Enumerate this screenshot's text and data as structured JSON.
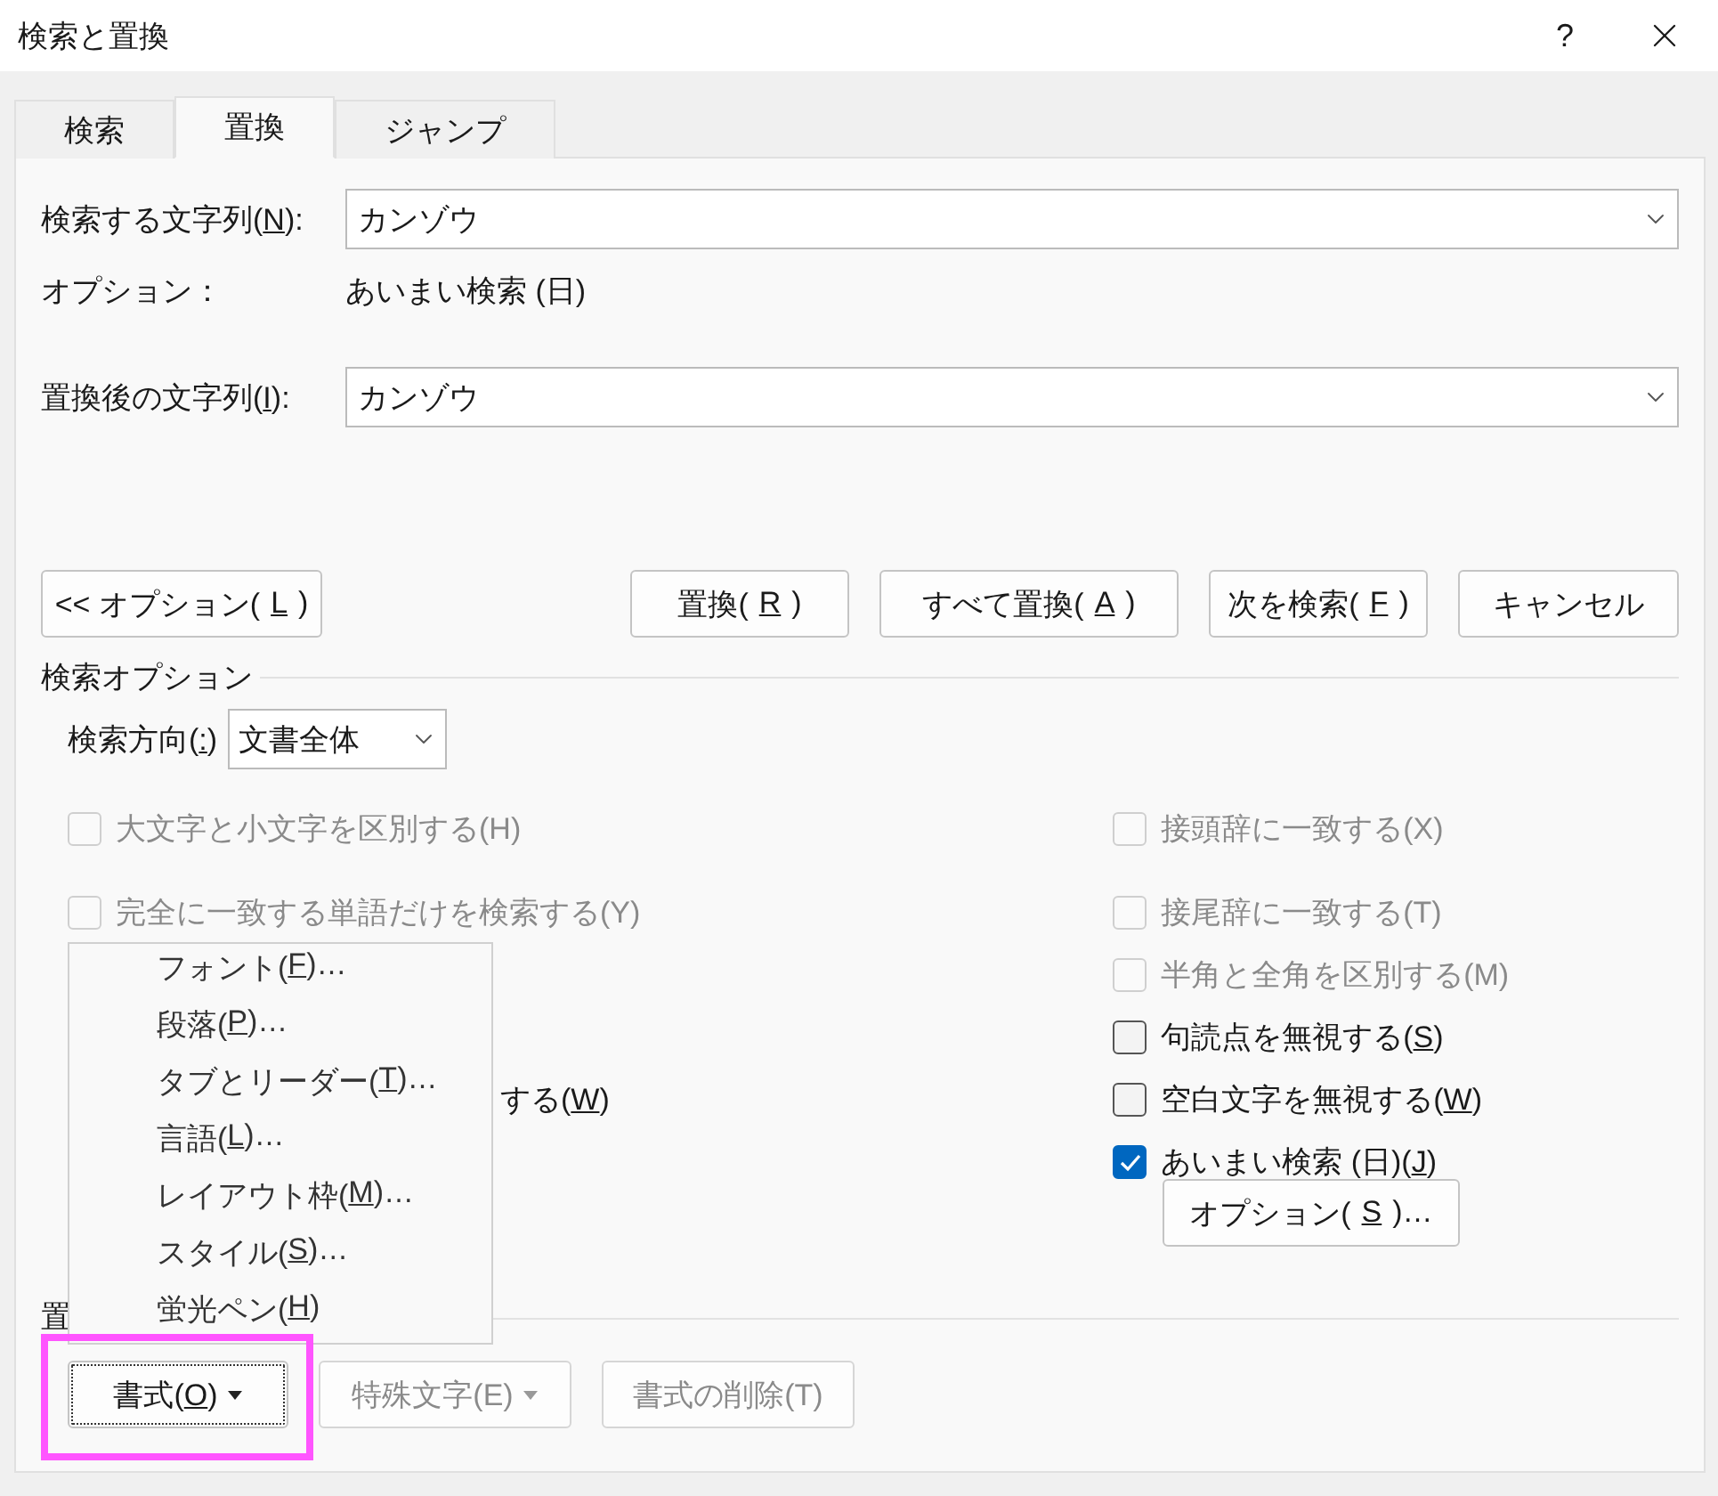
{
  "window": {
    "title": "検索と置換",
    "help": "?"
  },
  "tabs": [
    {
      "label": "検索",
      "selected": false
    },
    {
      "label": "置換",
      "selected": true
    },
    {
      "label": "ジャンプ",
      "selected": false
    }
  ],
  "find": {
    "label": [
      "検索する文字列(",
      "N",
      "):"
    ],
    "value": "カンゾウ"
  },
  "options_line": {
    "label": "オプション：",
    "value": "あいまい検索 (日)"
  },
  "replace": {
    "label": [
      "置換後の文字列(",
      "I",
      "):"
    ],
    "value": "カンゾウ"
  },
  "buttons": [
    {
      "label": [
        "<< オプション(",
        "L",
        ")"
      ]
    },
    {
      "label": [
        "置換(",
        "R",
        ")"
      ]
    },
    {
      "label": [
        "すべて置換(",
        "A",
        ")"
      ]
    },
    {
      "label": [
        "次を検索(",
        "F",
        ")"
      ]
    },
    {
      "label": "キャンセル"
    }
  ],
  "search_options": {
    "title": "検索オプション",
    "direction": {
      "label": [
        "検索方向(",
        ":",
        ")"
      ],
      "value": "文書全体"
    },
    "left": [
      {
        "kind": "checkbox",
        "label": "大文字と小文字を区別する(H)",
        "checked": false,
        "disabled": true
      },
      {
        "kind": "checkbox",
        "label": "完全に一致する単語だけを検索する(Y)",
        "checked": false,
        "disabled": true
      },
      {
        "kind": "fragment",
        "label": [
          "する(",
          "W",
          ")"
        ]
      }
    ],
    "right": [
      {
        "kind": "checkbox",
        "label": "接頭辞に一致する(X)",
        "checked": false,
        "disabled": true
      },
      {
        "kind": "checkbox",
        "label": "接尾辞に一致する(T)",
        "checked": false,
        "disabled": true
      },
      {
        "kind": "checkbox",
        "label": "半角と全角を区別する(M)",
        "checked": false,
        "disabled": true
      },
      {
        "kind": "checkbox",
        "label": [
          "句読点を無視する(",
          "S",
          ")"
        ],
        "checked": false,
        "disabled": false
      },
      {
        "kind": "checkbox",
        "label": [
          "空白文字を無視する(",
          "W",
          ")"
        ],
        "checked": false,
        "disabled": false
      },
      {
        "kind": "checkbox",
        "label": [
          "あいまい検索 (日)(",
          "J",
          ")"
        ],
        "checked": true,
        "disabled": false
      }
    ],
    "options_button": {
      "label": [
        "オプション(",
        "S",
        ")…"
      ]
    }
  },
  "replace_group": {
    "title": "置",
    "buttons": [
      {
        "label": [
          "書式(",
          "O",
          ")"
        ],
        "dropdown": true,
        "disabled": false,
        "focused": true
      },
      {
        "label": "特殊文字(E)",
        "dropdown": true,
        "disabled": true,
        "focused": false
      },
      {
        "label": "書式の削除(T)",
        "dropdown": false,
        "disabled": true,
        "focused": false
      }
    ]
  },
  "format_menu": [
    {
      "label": [
        "フォント(",
        "F",
        ")…"
      ]
    },
    {
      "label": [
        "段落(",
        "P",
        ")…"
      ]
    },
    {
      "label": [
        "タブとリーダー(",
        "T",
        ")…"
      ]
    },
    {
      "label": [
        "言語(",
        "L",
        ")…"
      ]
    },
    {
      "label": [
        "レイアウト枠(",
        "M",
        ")…"
      ]
    },
    {
      "label": [
        "スタイル(",
        "S",
        ")…"
      ]
    },
    {
      "label": [
        "蛍光ペン(",
        "H",
        ")"
      ]
    }
  ],
  "highlight_frame": {
    "color": "#ff55ff"
  }
}
